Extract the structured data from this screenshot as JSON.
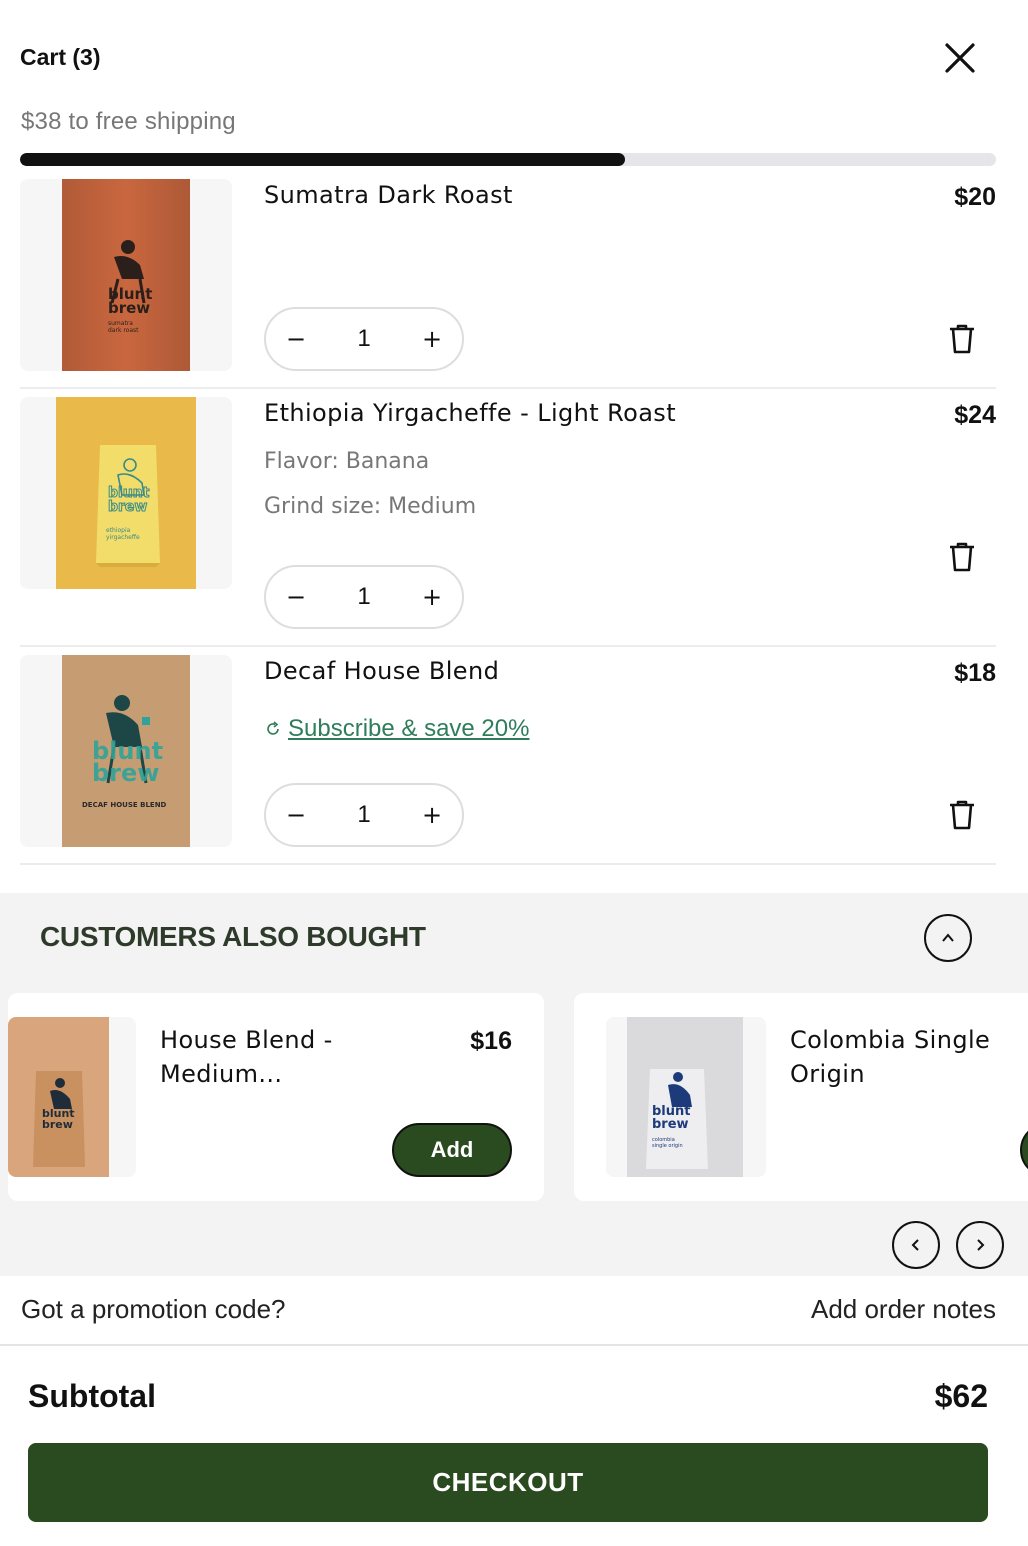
{
  "cart": {
    "title": "Cart (3)",
    "shipping_message": "$38 to free shipping",
    "shipping_progress": 0.62
  },
  "items": [
    {
      "name": "Sumatra Dark Roast",
      "price": "$20",
      "qty": "1",
      "pack_color": "#c9673f",
      "pack_lines": [
        "blunt",
        "brew"
      ],
      "pack_sub": "sumatra dark roast"
    },
    {
      "name": "Ethiopia Yirgacheffe - Light Roast",
      "price": "$24",
      "qty": "1",
      "flavor": "Flavor: Banana",
      "grind": "Grind size: Medium",
      "pack_color": "#f0d35a",
      "pack_lines": [
        "blunt",
        "brew"
      ],
      "pack_sub": "ethiopia yirgacheffe"
    },
    {
      "name": "Decaf House Blend",
      "price": "$18",
      "qty": "1",
      "subscribe": "Subscribe & save 20%",
      "pack_color": "#caa178",
      "pack_lines": [
        "blunt",
        "brew"
      ],
      "pack_sub": "DECAF HOUSE BLEND"
    }
  ],
  "upsell": {
    "title": "CUSTOMERS ALSO BOUGHT",
    "products": [
      {
        "name": "House Blend - Medium...",
        "price": "$16",
        "add_label": "Add"
      },
      {
        "name": "Colombia Single Origin",
        "price": "",
        "add_label": ""
      }
    ]
  },
  "footer": {
    "promo_label": "Got a promotion code?",
    "notes_label": "Add order notes",
    "subtotal_label": "Subtotal",
    "subtotal_value": "$62",
    "checkout_label": "CHECKOUT"
  },
  "colors": {
    "accent": "#2a4a1f",
    "subscribe": "#2f7d5a"
  }
}
